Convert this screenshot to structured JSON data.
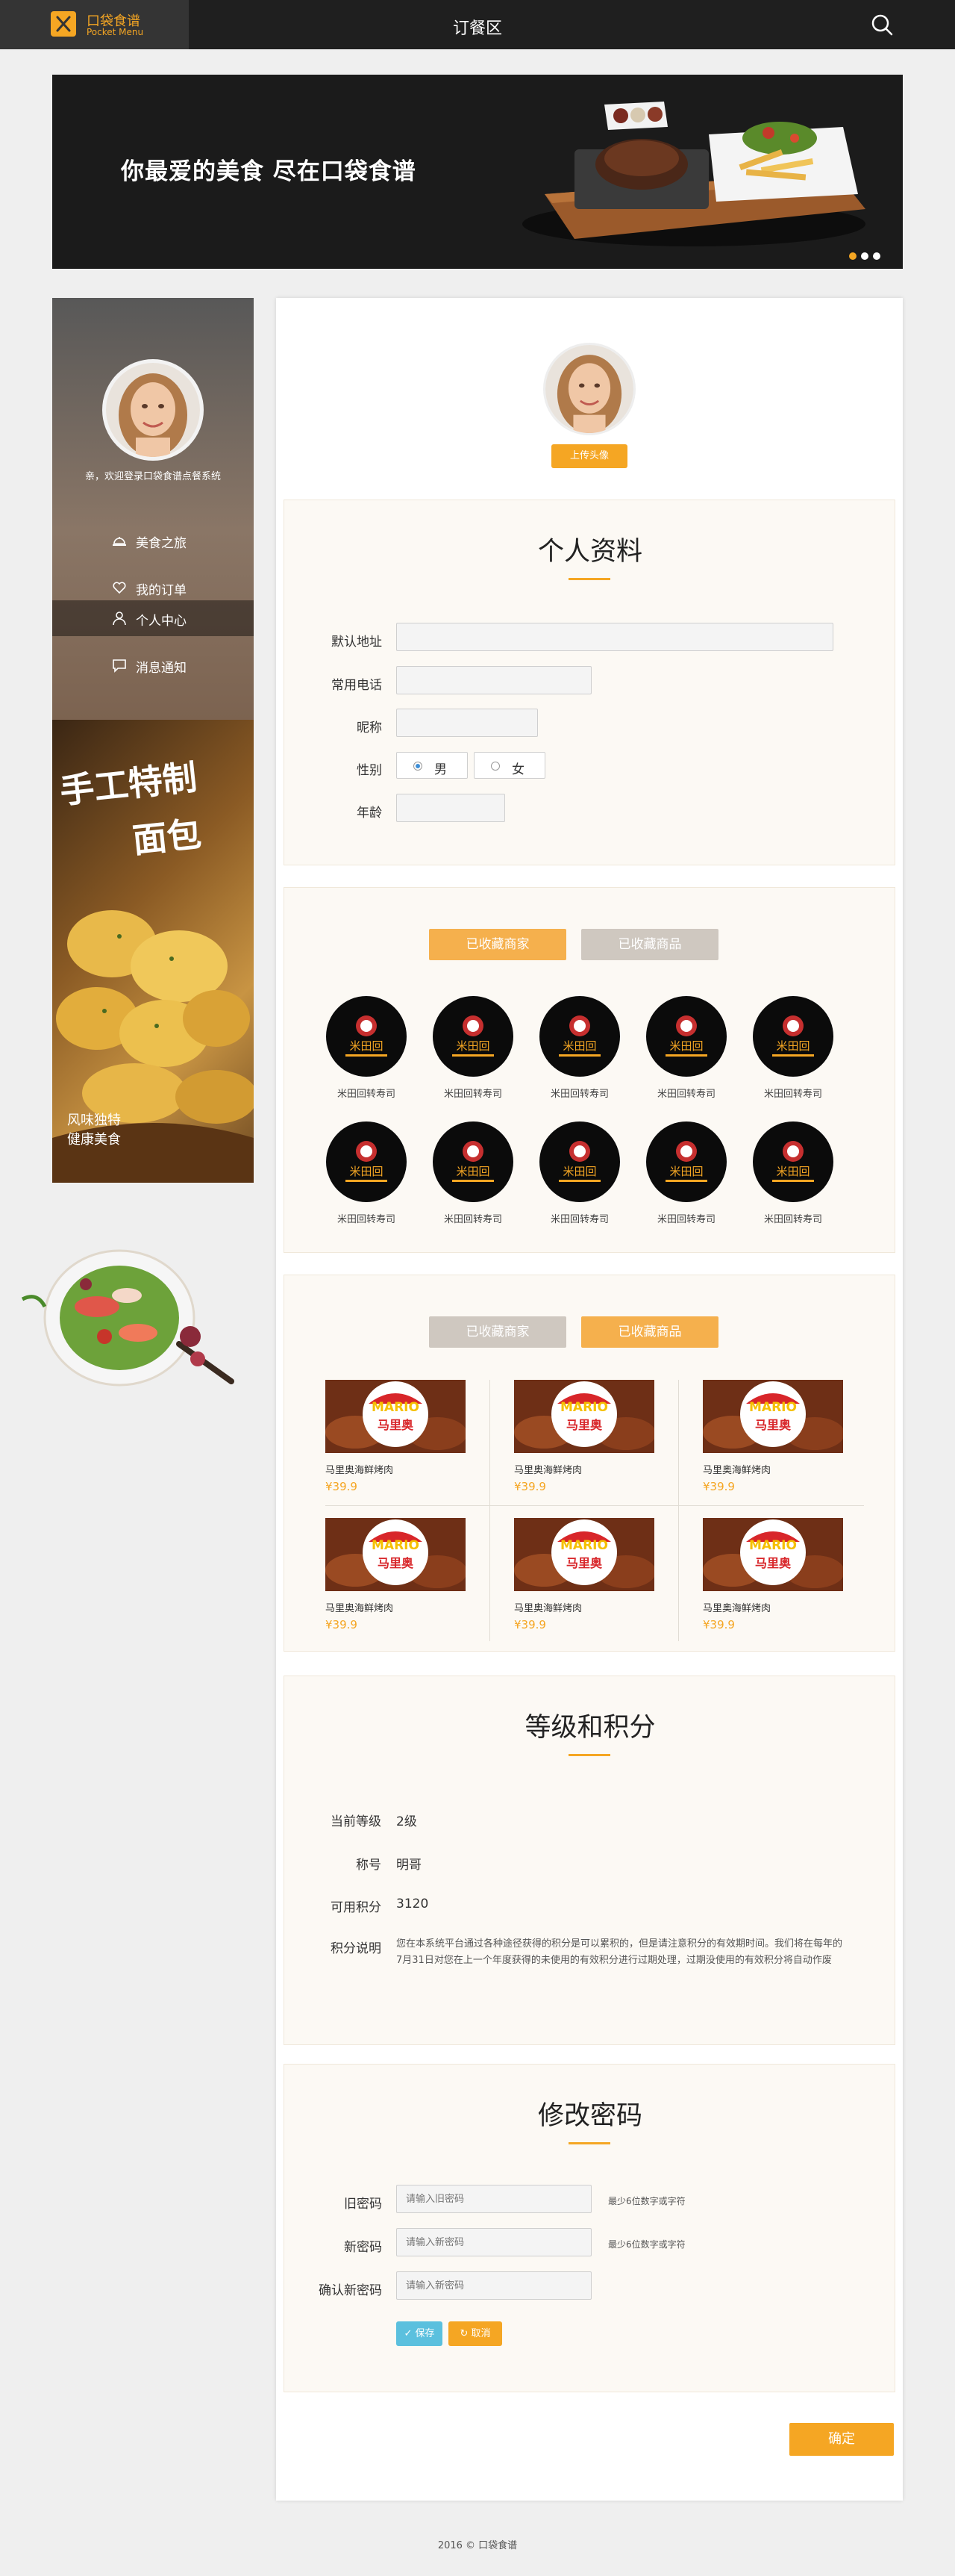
{
  "header": {
    "logo_name": "口袋食谱",
    "logo_sub": "Pocket Menu",
    "title": "订餐区"
  },
  "banner": {
    "slogan": "你最爱的美食 尽在口袋食谱",
    "dot_colors": [
      "#f5a623",
      "#ffffff",
      "#ffffff"
    ]
  },
  "sidebar": {
    "welcome": "亲，欢迎登录口袋食谱点餐系统",
    "nav": [
      {
        "label": "美食之旅",
        "icon": "dish-icon",
        "active": false
      },
      {
        "label": "我的订单",
        "icon": "heart-icon",
        "active": false
      },
      {
        "label": "个人中心",
        "icon": "user-icon",
        "active": true
      },
      {
        "label": "消息通知",
        "icon": "message-icon",
        "active": false
      }
    ],
    "promo": {
      "title_line1": "手工特制",
      "title_line2": "面包",
      "sub_line1": "风味独特",
      "sub_line2": "健康美食"
    }
  },
  "avatar": {
    "upload_label": "上传头像"
  },
  "profile": {
    "title": "个人资料",
    "address_label": "默认地址",
    "phone_label": "常用电话",
    "nickname_label": "昵称",
    "gender_label": "性别",
    "gender_male": "男",
    "gender_female": "女",
    "gender_selected": "男",
    "age_label": "年龄"
  },
  "favorites": {
    "tab_shops": "已收藏商家",
    "tab_products": "已收藏商品",
    "shops": [
      "米田回转寿司",
      "米田回转寿司",
      "米田回转寿司",
      "米田回转寿司",
      "米田回转寿司",
      "米田回转寿司",
      "米田回转寿司",
      "米田回转寿司",
      "米田回转寿司",
      "米田回转寿司"
    ],
    "shop_logo_text": "米田回",
    "products": [
      {
        "name": "马里奥海鲜烤肉",
        "price": "¥39.9"
      },
      {
        "name": "马里奥海鲜烤肉",
        "price": "¥39.9"
      },
      {
        "name": "马里奥海鲜烤肉",
        "price": "¥39.9"
      },
      {
        "name": "马里奥海鲜烤肉",
        "price": "¥39.9"
      },
      {
        "name": "马里奥海鲜烤肉",
        "price": "¥39.9"
      },
      {
        "name": "马里奥海鲜烤肉",
        "price": "¥39.9"
      }
    ],
    "product_brand": "MARIO",
    "product_brand_cn": "马里奥"
  },
  "level": {
    "title": "等级和积分",
    "level_label": "当前等级",
    "level_value": "2级",
    "name_label": "称号",
    "name_value": "明哥",
    "points_label": "可用积分",
    "points_value": "3120",
    "desc_label": "积分说明",
    "desc_text": "您在本系统平台通过各种途径获得的积分是可以累积的，但是请注意积分的有效期时间。我们将在每年的7月31日对您在上一个年度获得的未使用的有效积分进行过期处理，过期没使用的有效积分将自动作废"
  },
  "password": {
    "title": "修改密码",
    "old_label": "旧密码",
    "old_placeholder": "请输入旧密码",
    "old_hint": "最少6位数字或字符",
    "new_label": "新密码",
    "new_placeholder": "请输入新密码",
    "new_hint": "最少6位数字或字符",
    "confirm_label": "确认新密码",
    "confirm_placeholder": "请输入新密码",
    "save_label": "保存",
    "cancel_label": "取消"
  },
  "actions": {
    "confirm_label": "确定"
  },
  "footer": {
    "text": "2016 © 口袋食谱"
  },
  "colors": {
    "accent": "#f5a623",
    "header_bg": "#1f1f1f",
    "save_btn": "#5bc0de"
  }
}
